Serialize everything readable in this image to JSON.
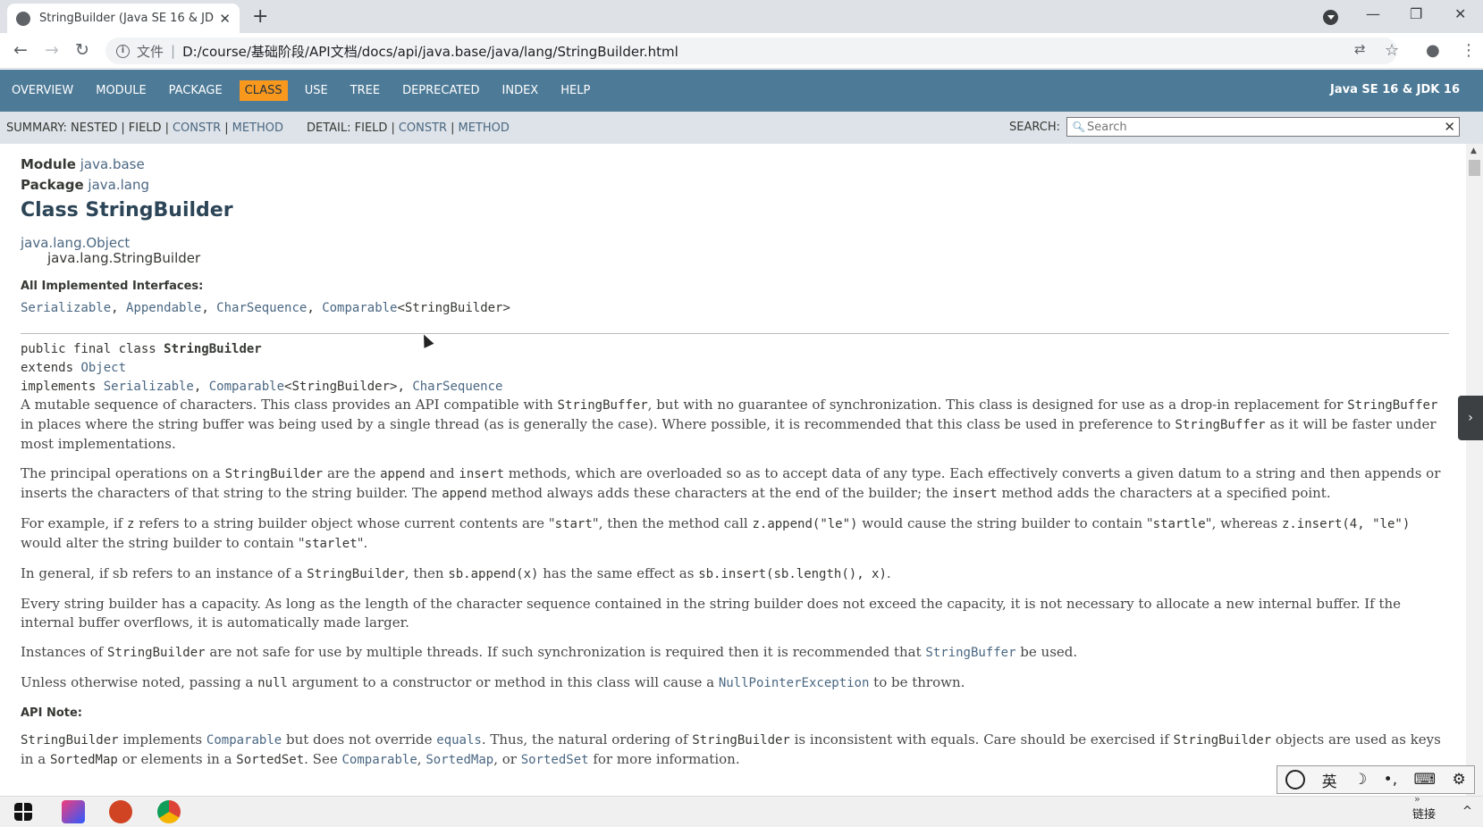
{
  "browser": {
    "tab_title": "StringBuilder (Java SE 16 & JDK",
    "tab_close": "✕",
    "new_tab": "+",
    "window_controls": {
      "minimize": "—",
      "restore": "❐",
      "close": "✕"
    },
    "back": "←",
    "forward": "→",
    "reload": "↻",
    "address_scheme": "文件",
    "address_separator": "|",
    "address_url": "D:/course/基础阶段/API文档/docs/api/java.base/java/lang/StringBuilder.html",
    "icons": [
      "info-icon",
      "translate-icon",
      "star-icon",
      "profile-icon",
      "more-icon"
    ]
  },
  "nav": {
    "items": [
      "OVERVIEW",
      "MODULE",
      "PACKAGE",
      "CLASS",
      "USE",
      "TREE",
      "DEPRECATED",
      "INDEX",
      "HELP"
    ],
    "active": "CLASS",
    "about": "Java SE 16 & JDK 16"
  },
  "subnav": {
    "summary_label": "SUMMARY:",
    "summary_nested": "NESTED",
    "summary_field": "FIELD",
    "summary_constr": "CONSTR",
    "summary_method": "METHOD",
    "detail_label": "DETAIL:",
    "detail_field": "FIELD",
    "detail_constr": "CONSTR",
    "detail_method": "METHOD",
    "pipe": "|",
    "search_label": "SEARCH:",
    "search_placeholder": "Search"
  },
  "header": {
    "module_label": "Module",
    "module_value": "java.base",
    "package_label": "Package",
    "package_value": "java.lang",
    "title": "Class StringBuilder",
    "inherit_parent": "java.lang.Object",
    "inherit_child": "java.lang.StringBuilder",
    "impl_header": "All Implemented Interfaces:",
    "impl_serializable": "Serializable",
    "impl_appendable": "Appendable",
    "impl_charsequence": "CharSequence",
    "impl_comparable": "Comparable",
    "impl_generic": "<StringBuilder>"
  },
  "signature": {
    "line1_prefix": "public final class ",
    "line1_name": "StringBuilder",
    "line2_prefix": "extends ",
    "line2_link": "Object",
    "line3_prefix": "implements ",
    "line3_link1": "Serializable",
    "line3_sep1": ", ",
    "line3_link2": "Comparable",
    "line3_generic": "<StringBuilder>",
    "line3_sep2": ", ",
    "line3_link3": "CharSequence"
  },
  "description": {
    "p1": [
      "A mutable sequence of characters. This class provides an API compatible with ",
      "StringBuffer",
      ", but with no guarantee of synchronization. This class is designed for use as a drop-in replacement for ",
      "StringBuffer",
      " in places where the string buffer was being used by a single thread (as is generally the case). Where possible, it is recommended that this class be used in preference to ",
      "StringBuffer",
      " as it will be faster under most implementations."
    ],
    "p2": [
      "The principal operations on a ",
      "StringBuilder",
      " are the ",
      "append",
      " and ",
      "insert",
      " methods, which are overloaded so as to accept data of any type. Each effectively converts a given datum to a string and then appends or inserts the characters of that string to the string builder. The ",
      "append",
      " method always adds these characters at the end of the builder; the ",
      "insert",
      " method adds the characters at a specified point."
    ],
    "p3": [
      "For example, if ",
      "z",
      " refers to a string builder object whose current contents are \"",
      "start",
      "\", then the method call ",
      "z.append(\"le\")",
      " would cause the string builder to contain \"",
      "startle",
      "\", whereas ",
      "z.insert(4, \"le\")",
      " would alter the string builder to contain \"",
      "starlet",
      "\"."
    ],
    "p4": [
      "In general, if sb refers to an instance of a ",
      "StringBuilder",
      ", then ",
      "sb.append(x)",
      " has the same effect as ",
      "sb.insert(sb.length(), x)",
      "."
    ],
    "p5": "Every string builder has a capacity. As long as the length of the character sequence contained in the string builder does not exceed the capacity, it is not necessary to allocate a new internal buffer. If the internal buffer overflows, it is automatically made larger.",
    "p6": [
      "Instances of ",
      "StringBuilder",
      " are not safe for use by multiple threads. If such synchronization is required then it is recommended that ",
      "StringBuffer",
      " be used."
    ],
    "p7": [
      "Unless otherwise noted, passing a ",
      "null",
      " argument to a constructor or method in this class will cause a ",
      "NullPointerException",
      " to be thrown."
    ],
    "api_note_label": "API Note:",
    "p8": [
      "StringBuilder",
      " implements ",
      "Comparable",
      " but does not override ",
      "equals",
      ". Thus, the natural ordering of ",
      "StringBuilder",
      " is inconsistent with equals. Care should be exercised if ",
      "StringBuilder",
      " objects are used as keys in a ",
      "SortedMap",
      " or elements in a ",
      "SortedSet",
      ". See ",
      "Comparable",
      ", ",
      "SortedMap",
      ", or ",
      "SortedSet",
      " for more information."
    ]
  },
  "ime": {
    "items": [
      "英",
      "☽",
      "•,",
      "⌨",
      "⚙"
    ]
  },
  "taskbar": {
    "tray_text": "链接",
    "tray_arrows": "»",
    "tray_chevron": "^"
  },
  "colors": {
    "nav_bg": "#4d7a97",
    "active_bg": "#f8981d",
    "link": "#4a6782",
    "subnav_bg": "#dee3e9"
  }
}
